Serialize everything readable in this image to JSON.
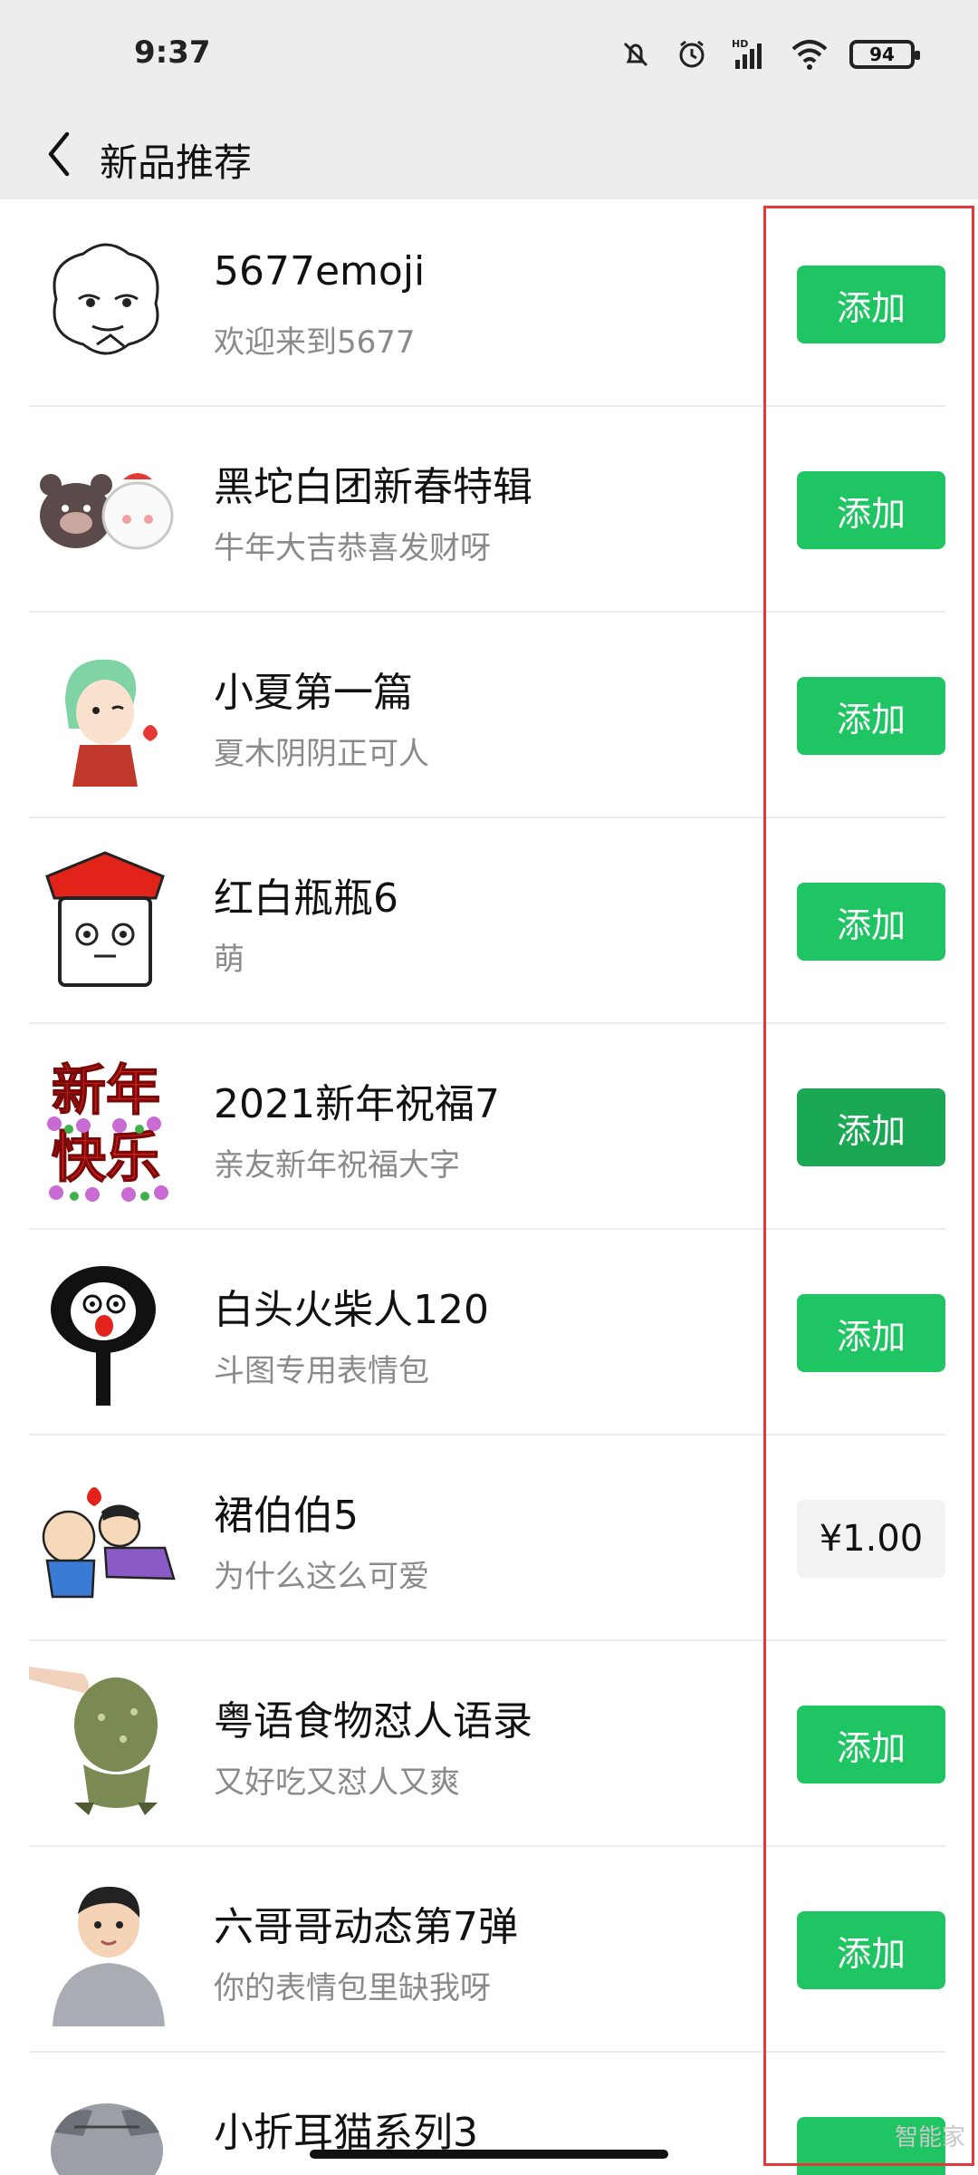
{
  "status_bar": {
    "time": "9:37",
    "battery": "94",
    "icons": [
      "mute-icon",
      "alarm-icon",
      "hd-signal-icon",
      "wifi-icon",
      "battery-icon"
    ]
  },
  "nav": {
    "title": "新品推荐"
  },
  "items": [
    {
      "title": "5677emoji",
      "subtitle": "欢迎来到5677",
      "action": "添加"
    },
    {
      "title": "黑坨白团新春特辑",
      "subtitle": "牛年大吉恭喜发财呀",
      "action": "添加"
    },
    {
      "title": "小夏第一篇",
      "subtitle": "夏木阴阴正可人",
      "action": "添加"
    },
    {
      "title": "红白瓶瓶6",
      "subtitle": "萌",
      "action": "添加"
    },
    {
      "title": "2021新年祝福7",
      "subtitle": "亲友新年祝福大字",
      "action": "添加"
    },
    {
      "title": "白头火柴人120",
      "subtitle": "斗图专用表情包",
      "action": "添加"
    },
    {
      "title": "裙伯伯5",
      "subtitle": "为什么这么可爱",
      "action": "¥1.00"
    },
    {
      "title": "粤语食物怼人语录",
      "subtitle": "又好吃又怼人又爽",
      "action": "添加"
    },
    {
      "title": "六哥哥动态第7弹",
      "subtitle": "你的表情包里缺我呀",
      "action": "添加"
    },
    {
      "title": "小折耳猫系列3",
      "subtitle": "",
      "action": ""
    }
  ],
  "thumb_text": {
    "new_year": [
      "新年",
      "快乐"
    ]
  },
  "colors": {
    "accent_green": "#1fc563",
    "highlight_red": "#e53935",
    "header_bg": "#ededed"
  },
  "watermark": "智能家"
}
